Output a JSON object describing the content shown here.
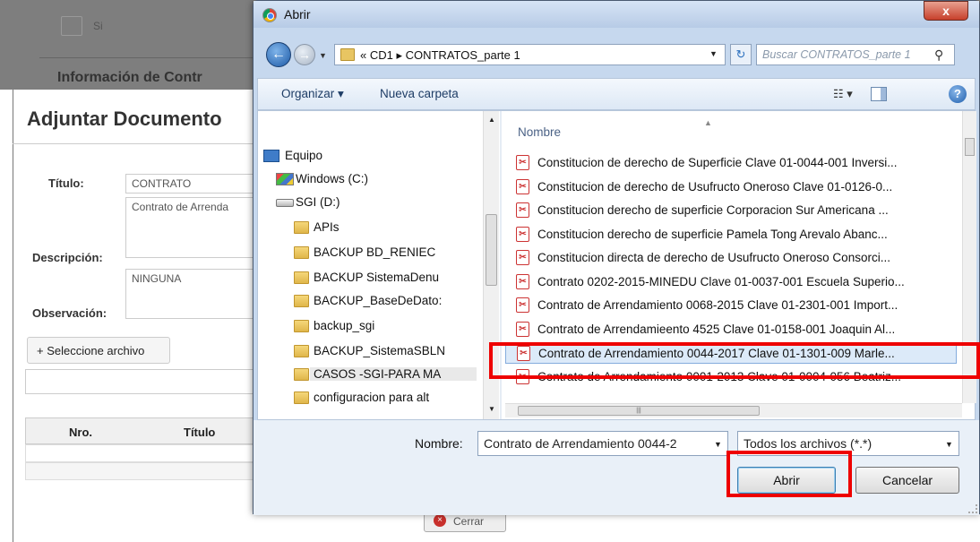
{
  "background": {
    "si_label": "Si",
    "info_title": "Información de Contr",
    "heading": "Adjuntar Documento",
    "titulo_label": "Título:",
    "titulo_value": "CONTRATO",
    "descripcion_label": "Descripción:",
    "descripcion_value": "Contrato de Arrenda",
    "observacion_label": "Observación:",
    "observacion_value": "NINGUNA",
    "select_file_button": "+ Seleccione archivo",
    "table_headers": [
      "Nro.",
      "Título"
    ],
    "close_button": "Cerrar"
  },
  "dialog": {
    "title": "Abrir",
    "close": "x",
    "address": "« CD1 ▸ CONTRATOS_parte 1",
    "search_placeholder": "Buscar CONTRATOS_parte 1",
    "organize": "Organizar ▾",
    "new_folder": "Nueva carpeta",
    "views": "☷ ▾",
    "help": "?",
    "nav": [
      {
        "label": "Equipo",
        "icon": "computer-icon"
      },
      {
        "label": "Windows (C:)",
        "icon": "windows-drive-icon"
      },
      {
        "label": "SGI (D:)",
        "icon": "drive-icon"
      },
      {
        "label": "APIs",
        "icon": "folder-icon"
      },
      {
        "label": "BACKUP BD_RENIEC",
        "icon": "folder-icon"
      },
      {
        "label": "BACKUP SistemaDenu",
        "icon": "folder-icon"
      },
      {
        "label": "BACKUP_BaseDeDato:",
        "icon": "folder-icon"
      },
      {
        "label": "backup_sgi",
        "icon": "folder-icon"
      },
      {
        "label": "BACKUP_SistemaSBLN",
        "icon": "folder-icon"
      },
      {
        "label": "CASOS -SGI-PARA MA",
        "icon": "folder-icon"
      },
      {
        "label": "configuracion para alt",
        "icon": "folder-icon"
      }
    ],
    "column_name": "Nombre",
    "files": [
      "Constitucion de derecho de Superficie Clave 01-0044-001 Inversi...",
      "Constitucion de derecho de Usufructo Oneroso Clave 01-0126-0...",
      "Constitucion derecho de superficie Corporacion Sur Americana ...",
      "Constitucion derecho de superficie Pamela Tong Arevalo Abanc...",
      "Constitucion directa de derecho de Usufructo Oneroso Consorci...",
      "Contrato 0202-2015-MINEDU Clave 01-0037-001 Escuela Superio...",
      "Contrato de Arrendamiento 0068-2015 Clave 01-2301-001 Import...",
      "Contrato de Arrendamieento 4525 Clave 01-0158-001 Joaquin Al...",
      "Contrato de Arrendamiento  0044-2017 Clave 01-1301-009 Marle...",
      "Contrato de Arrendamiento 0001-2013 Clave 01-0004-056 Beatriz..."
    ],
    "selected_index": 8,
    "filename_label": "Nombre:",
    "filename_value": "Contrato de Arrendamiento  0044-2",
    "filetype_value": "Todos los archivos (*.*)",
    "open_button": "Abrir",
    "cancel_button": "Cancelar"
  },
  "colors": {
    "highlight": "#e00000",
    "selection": "#dceaf9"
  }
}
